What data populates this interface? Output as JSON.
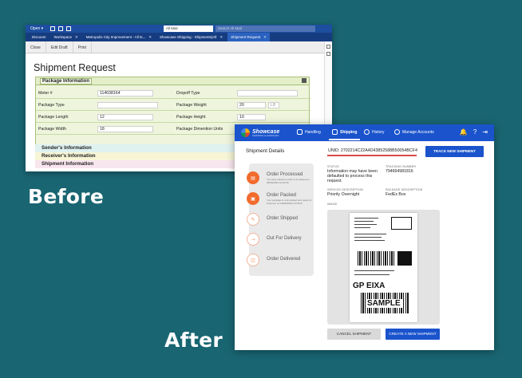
{
  "labels": {
    "before": "Before",
    "after": "After"
  },
  "before": {
    "topbar": {
      "open": "Open ▾",
      "all_mail": "All Mail",
      "search_placeholder": "Search All Mail"
    },
    "tabs": [
      {
        "label": "Discover"
      },
      {
        "label": "Workspace"
      },
      {
        "label": "Metropolis City Improvement - All ts..."
      },
      {
        "label": "Showcase Shipping - Shipments(All"
      },
      {
        "label": "Shipment Request"
      }
    ],
    "toolbar": {
      "close": "Close",
      "edit_draft": "Edit Draft",
      "print": "Print"
    },
    "title": "Shipment Request",
    "package_section": "Package Information",
    "fields": {
      "meter_label": "Meter #",
      "meter_value": "114038164",
      "dropoff_label": "Dropoff Type",
      "dropoff_value": "",
      "package_type_label": "Package Type",
      "package_type_value": "",
      "weight_label": "Package Weight",
      "weight_value": "20",
      "weight_unit": "LB",
      "length_label": "Package Length",
      "length_value": "12",
      "height_label": "Package Height",
      "height_value": "10",
      "width_label": "Package Width",
      "width_value": "18",
      "dimension_units_label": "Package Dimention Units"
    },
    "sections": {
      "sender": "Sender's Information",
      "receiver": "Receiver's Information",
      "shipment": "Shipment Information"
    }
  },
  "after": {
    "brand": {
      "name": "Showcase",
      "tagline": "SHIPPING & HANDLING"
    },
    "nav": {
      "handling": "Handling",
      "shipping": "Shipping",
      "history": "History",
      "manage_accounts": "Manage Accounts"
    },
    "title": "Shipment Details",
    "unid": "UNID: 2702214C22A4D43852588B50054BCF4",
    "track_button": "TRACK NEW SHIPMENT",
    "steps": [
      {
        "label": "Order Processed",
        "desc": "You have placed a order to be placed on 09/06/2022 10:20:20",
        "state": "done"
      },
      {
        "label": "Order Packed",
        "desc": "Your package is now packed and ready for shipment on 09/06/2022 10:25:00",
        "state": "done"
      },
      {
        "label": "Order Shipped",
        "desc": "",
        "state": "pending"
      },
      {
        "label": "Out For Delivery",
        "desc": "",
        "state": "pending"
      },
      {
        "label": "Order Delivered",
        "desc": "",
        "state": "pending"
      }
    ],
    "details": {
      "status_label": "STATUS",
      "status_value": "Information may have been defaulted to process this request.",
      "tracking_label": "TRACKING NUMBER",
      "tracking_value": "794664981816",
      "service_label": "SERVICE DESCRIPTION",
      "service_value": "Priority Overnight",
      "package_desc_label": "PACKAGE DESCRIPTION",
      "package_desc_value": "FedEx Box",
      "image_label": "IMAGE"
    },
    "label_image": {
      "route_code": "GP EIXA",
      "stamp": "SAMPLE"
    },
    "cancel_button": "CANCEL SHIPMENT",
    "create_button": "CREATE A NEW SHIPMENT"
  }
}
